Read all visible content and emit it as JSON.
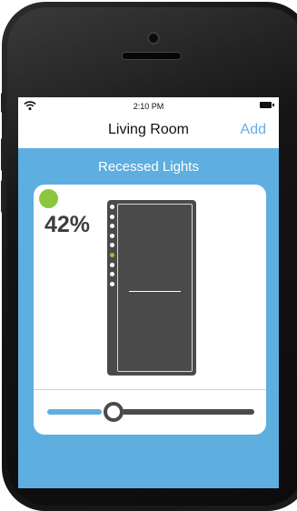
{
  "status_bar": {
    "time": "2:10 PM",
    "wifi_icon": "wifi-icon",
    "battery_icon": "battery-icon"
  },
  "nav": {
    "title": "Living Room",
    "add_label": "Add"
  },
  "section": {
    "title": "Recessed Lights"
  },
  "device": {
    "level_text": "42%",
    "level_fraction": 0.42,
    "status_color": "#8cc63f",
    "led_count": 9,
    "active_led_index": 5
  },
  "slider": {
    "value_fraction": 0.32
  },
  "colors": {
    "accent": "#5eaee0",
    "on_indicator": "#8cc63f",
    "dimmer_body": "#4a4a4a"
  }
}
